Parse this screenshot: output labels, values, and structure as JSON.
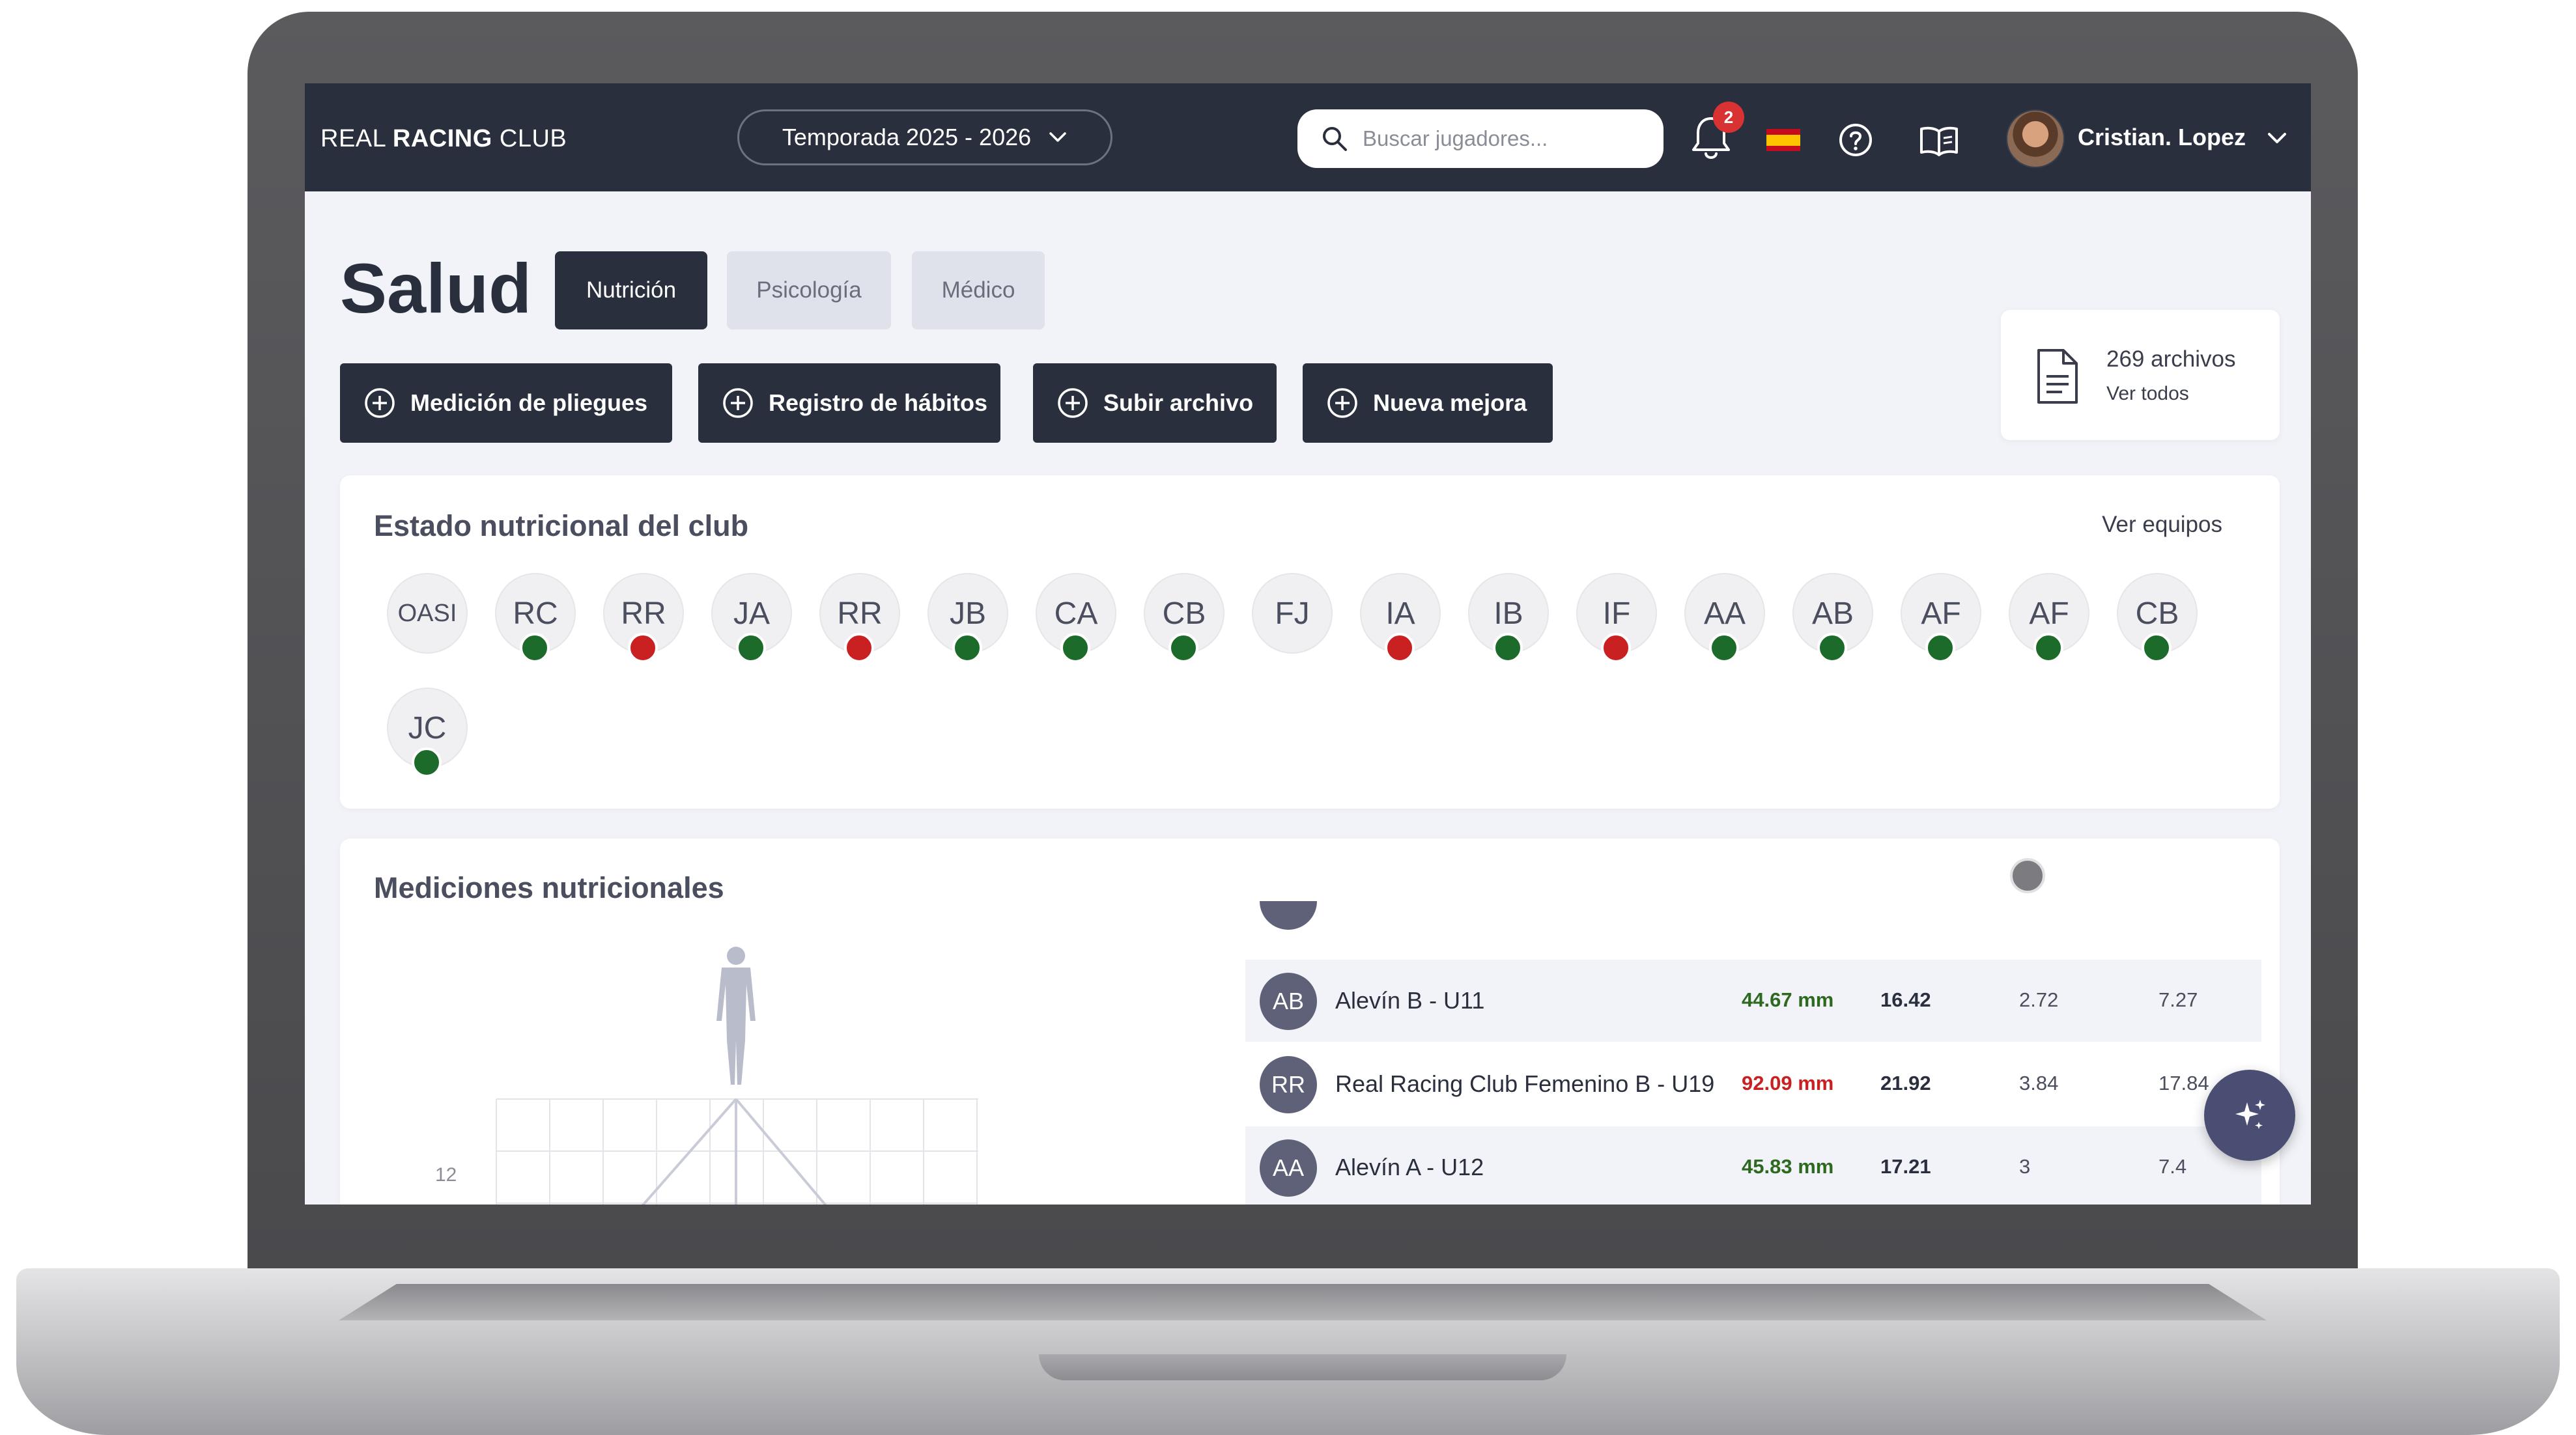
{
  "header": {
    "brand_prefix": "REAL",
    "brand_bold": "RACING",
    "brand_suffix": "CLUB",
    "season_label": "Temporada 2025 - 2026",
    "search_placeholder": "Buscar jugadores...",
    "notifications_count": "2",
    "user_name": "Cristian. Lopez"
  },
  "page": {
    "title": "Salud",
    "tabs": [
      {
        "label": "Nutrición",
        "active": true
      },
      {
        "label": "Psicología",
        "active": false
      },
      {
        "label": "Médico",
        "active": false
      }
    ],
    "actions": [
      {
        "label": "Medición de pliegues"
      },
      {
        "label": "Registro de hábitos"
      },
      {
        "label": "Subir archivo"
      },
      {
        "label": "Nueva mejora"
      }
    ],
    "files": {
      "count_label": "269 archivos",
      "link_label": "Ver todos"
    }
  },
  "club_status": {
    "title": "Estado nutricional del club",
    "link": "Ver equipos",
    "colors": {
      "good": "#1d6b2a",
      "bad": "#c92121"
    },
    "teams": [
      {
        "initials": "OASI",
        "status": "none"
      },
      {
        "initials": "RC",
        "status": "good"
      },
      {
        "initials": "RR",
        "status": "bad"
      },
      {
        "initials": "JA",
        "status": "good"
      },
      {
        "initials": "RR",
        "status": "bad"
      },
      {
        "initials": "JB",
        "status": "good"
      },
      {
        "initials": "CA",
        "status": "good"
      },
      {
        "initials": "CB",
        "status": "good"
      },
      {
        "initials": "FJ",
        "status": "none"
      },
      {
        "initials": "IA",
        "status": "bad"
      },
      {
        "initials": "IB",
        "status": "good"
      },
      {
        "initials": "IF",
        "status": "bad"
      },
      {
        "initials": "AA",
        "status": "good"
      },
      {
        "initials": "AB",
        "status": "good"
      },
      {
        "initials": "AF",
        "status": "good"
      },
      {
        "initials": "AF",
        "status": "good"
      },
      {
        "initials": "CB",
        "status": "good"
      },
      {
        "initials": "JC",
        "status": "good"
      }
    ]
  },
  "measurements": {
    "title": "Mediciones nutricionales",
    "axis_tick": "12",
    "rows": [
      {
        "initials": "AB",
        "name": "Alevín B - U11",
        "mm": "44.67 mm",
        "mm_status": "good",
        "c1": "16.42",
        "c2": "2.72",
        "c3": "7.27"
      },
      {
        "initials": "RR",
        "name": "Real Racing Club Femenino B - U19",
        "mm": "92.09 mm",
        "mm_status": "bad",
        "c1": "21.92",
        "c2": "3.84",
        "c3": "17.84"
      },
      {
        "initials": "AA",
        "name": "Alevín A - U12",
        "mm": "45.83 mm",
        "mm_status": "good",
        "c1": "17.21",
        "c2": "3",
        "c3": "7.4"
      }
    ]
  }
}
